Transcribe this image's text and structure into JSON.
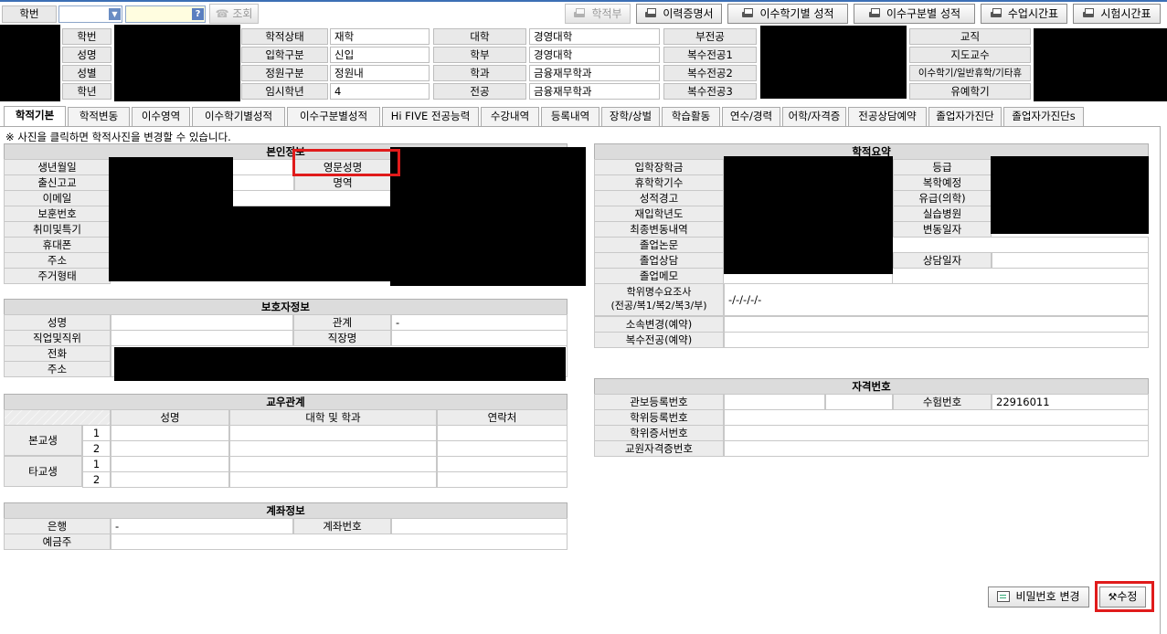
{
  "search": {
    "label": "학번",
    "query_button": "조회",
    "help": "?"
  },
  "toolbar": {
    "hakjeokbu": "학적부",
    "history_cert": "이력증명서",
    "by_semester": "이수학기별 성적",
    "by_category": "이수구분별 성적",
    "class_schedule": "수업시간표",
    "exam_schedule": "시험시간표"
  },
  "header": {
    "l_hakbun": "학번",
    "l_name": "성명",
    "l_gender": "성별",
    "l_grade": "학년",
    "l_status": "학적상태",
    "v_status": "재학",
    "l_entrytype": "입학구분",
    "v_entrytype": "신입",
    "l_quota": "정원구분",
    "v_quota": "정원내",
    "l_tempgrade": "임시학년",
    "v_tempgrade": "4",
    "l_college": "대학",
    "v_college": "경영대학",
    "l_division": "학부",
    "v_division": "경영대학",
    "l_dept": "학과",
    "v_dept": "금융재무학과",
    "l_major": "전공",
    "v_major": "금융재무학과",
    "l_minor": "부전공",
    "l_double1": "복수전공1",
    "l_double2": "복수전공2",
    "l_double3": "복수전공3",
    "l_staff": "교직",
    "l_advisor": "지도교수",
    "l_leave": "이수학기/일반휴학/기타휴",
    "l_deferred": "유예학기"
  },
  "tabs": [
    "학적기본",
    "학적변동",
    "이수영역",
    "이수학기별성적",
    "이수구분별성적",
    "Hi FIVE 전공능력",
    "수강내역",
    "등록내역",
    "장학/상벌",
    "학습활동",
    "연수/경력",
    "어학/자격증",
    "전공상담예약",
    "졸업자가진단",
    "졸업자가진단s"
  ],
  "notice": "※ 사진을 클릭하면 학적사진을 변경할 수 있습니다.",
  "personal": {
    "title": "본인정보",
    "birth": "생년월일",
    "school": "출신고교",
    "email": "이메일",
    "veteran": "보훈번호",
    "hobby": "취미및특기",
    "mobile": "휴대폰",
    "address": "주소",
    "housing": "주거형태",
    "eng_name": "영문성명",
    "chn_name": "명역"
  },
  "guardian": {
    "title": "보호자정보",
    "name": "성명",
    "relation": "관계",
    "relation_value": "-",
    "job": "직업및직위",
    "workplace": "직장명",
    "phone": "전화",
    "address": "주소"
  },
  "friends": {
    "title": "교우관계",
    "col_name": "성명",
    "col_dept": "대학 및 학과",
    "col_contact": "연락처",
    "row_internal": "본교생",
    "row_external": "타교생",
    "n1": "1",
    "n2": "2"
  },
  "account": {
    "title": "계좌정보",
    "bank": "은행",
    "bank_value": "-",
    "acct_no": "계좌번호",
    "holder": "예금주"
  },
  "summary": {
    "title": "학적요약",
    "scholarship": "입학장학금",
    "leave_count": "휴학학기수",
    "warning": "성적경고",
    "reentry": "재입학년도",
    "last_change": "최종변동내역",
    "thesis": "졸업논문",
    "counsel": "졸업상담",
    "memo": "졸업메모",
    "survey": "학위명수요조사",
    "survey_sub": "(전공/복1/복2/복3/부)",
    "survey_value": "-/-/-/-/-",
    "affil_change": "소속변경(예약)",
    "double_res": "복수전공(예약)",
    "rank": "등급",
    "return": "복학예정",
    "paid_leave": "유급(의학)",
    "hospital": "실습병원",
    "change_date": "변동일자",
    "counsel_date": "상담일자"
  },
  "license": {
    "title": "자격번호",
    "license_no": "관보등록번호",
    "degree_reg": "학위등록번호",
    "degree_cert": "학위증서번호",
    "teacher_cert": "교원자격증번호",
    "exam_no": "수험번호",
    "exam_value": "22916011"
  },
  "footer": {
    "pw_change": "비밀번호 변경",
    "edit": "수정"
  }
}
